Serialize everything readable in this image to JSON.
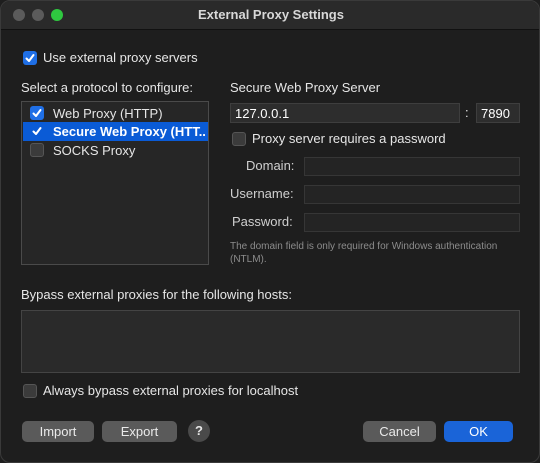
{
  "window": {
    "title": "External Proxy Settings"
  },
  "use_external": {
    "label": "Use external proxy servers",
    "checked": true
  },
  "protocol_section": {
    "label": "Select a protocol to configure:"
  },
  "protocols": [
    {
      "label": "Web Proxy (HTTP)",
      "checked": true,
      "selected": false
    },
    {
      "label": "Secure Web Proxy (HTT...",
      "checked": true,
      "selected": true
    },
    {
      "label": "SOCKS Proxy",
      "checked": false,
      "selected": false
    }
  ],
  "server": {
    "heading": "Secure Web Proxy Server",
    "host": "127.0.0.1",
    "separator": ":",
    "port": "7890",
    "requires_password": {
      "label": "Proxy server requires a password",
      "checked": false
    },
    "domain_label": "Domain:",
    "domain_value": "",
    "username_label": "Username:",
    "username_value": "",
    "password_label": "Password:",
    "password_value": "",
    "note": "The domain field is only required for Windows authentication (NTLM)."
  },
  "bypass": {
    "label": "Bypass external proxies for the following hosts:",
    "hosts": "",
    "localhost": {
      "label": "Always bypass external proxies for localhost",
      "checked": false
    }
  },
  "buttons": {
    "import": "Import",
    "export": "Export",
    "help": "?",
    "cancel": "Cancel",
    "ok": "OK"
  },
  "colors": {
    "accent": "#1f6fe6",
    "selection": "#0a5bd6",
    "window_bg": "#1e1e1e",
    "maximize": "#2fc840"
  }
}
